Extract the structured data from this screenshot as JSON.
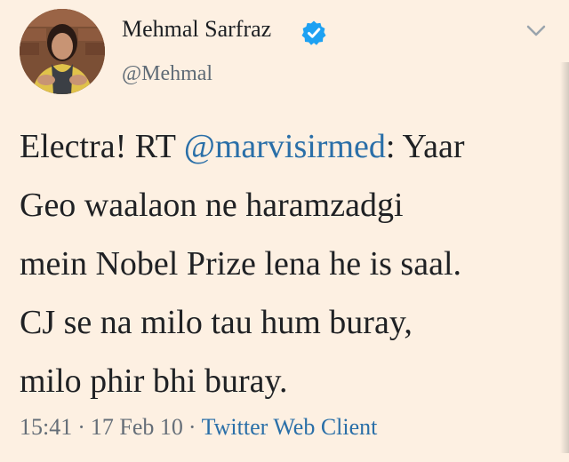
{
  "author": {
    "display_name": "Mehmal Sarfraz",
    "handle": "@Mehmal",
    "verified": true,
    "avatar_icon": "profile-photo"
  },
  "tweet": {
    "lines": [
      {
        "pre": "Electra! RT ",
        "mention": "@marvisirmed",
        "post": ": Yaar"
      },
      {
        "text": "Geo waalaon ne haramzadgi"
      },
      {
        "text": "mein Nobel Prize lena he is saal."
      },
      {
        "text": "CJ se na milo tau hum buray,"
      },
      {
        "text": "milo phir bhi buray."
      }
    ]
  },
  "meta": {
    "time": "15:41",
    "separator": "·",
    "date": "17 Feb 10",
    "client": "Twitter Web Client"
  },
  "colors": {
    "background": "#fdf0e2",
    "link": "#2a6fa8",
    "verified_badge": "#1da1f2"
  },
  "icons": {
    "verified": "verified-badge-icon",
    "menu": "chevron-down-icon"
  }
}
